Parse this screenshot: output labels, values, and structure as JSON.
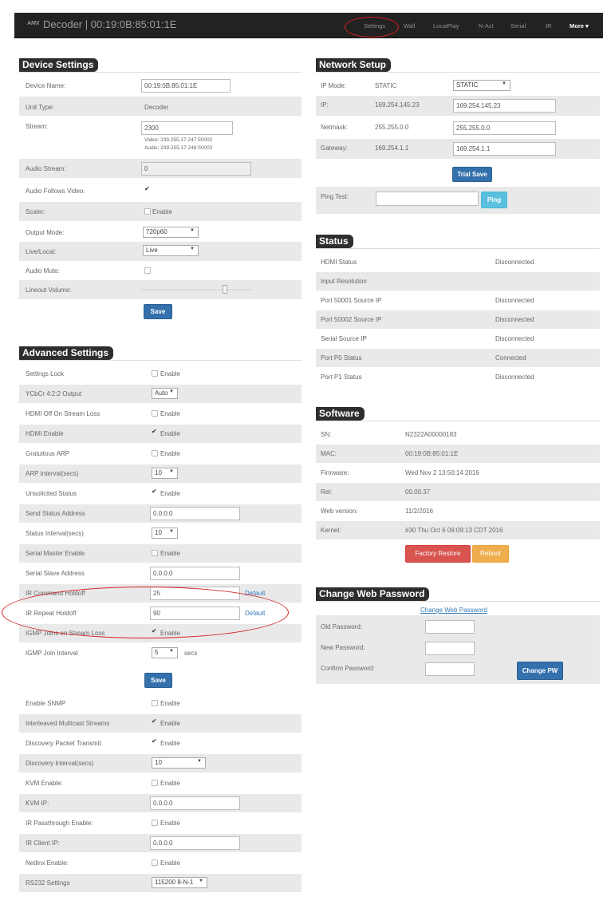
{
  "navbar": {
    "logo": "AMX",
    "title": "Decoder | 00:19:0B:85:01:1E",
    "links": [
      "Settings",
      "Wall",
      "LocalPlay",
      "N-Act",
      "Serial",
      "IR"
    ],
    "more": "More ▾"
  },
  "device_settings": {
    "title": "Device Settings",
    "device_name_label": "Device Name:",
    "device_name_value": "00:19:0B:85:01:1E",
    "unit_type_label": "Unit Type:",
    "unit_type_value": "Decoder",
    "stream_label": "Stream:",
    "stream_value": "2300",
    "stream_video": "Video: 239.255.17.247:50002",
    "stream_audio": "Audio: 239.255.17.248:50003",
    "audio_stream_label": "Audio Stream:",
    "audio_stream_value": "0",
    "audio_follows_label": "Audio Follows Video:",
    "scaler_label": "Scaler:",
    "scaler_chk": "Enable",
    "output_mode_label": "Output Mode:",
    "output_mode_value": "720p60",
    "live_local_label": "Live/Local:",
    "live_local_value": "Live",
    "audio_mute_label": "Audio Mute:",
    "lineout_label": "Lineout Volume:",
    "save": "Save"
  },
  "advanced": {
    "title": "Advanced Settings",
    "rows": [
      {
        "label": "Settings Lock",
        "kind": "chk",
        "checked": false,
        "text": "Enable"
      },
      {
        "label": "YCbCr 4:2:2 Output",
        "kind": "sel",
        "text": "Auto"
      },
      {
        "label": "HDMI Off On Stream Loss",
        "kind": "chk",
        "checked": false,
        "text": "Enable"
      },
      {
        "label": "HDMI Enable",
        "kind": "chk",
        "checked": true,
        "text": "Enable"
      },
      {
        "label": "Gratuitous ARP",
        "kind": "chk",
        "checked": false,
        "text": "Enable"
      },
      {
        "label": "ARP Interval(secs)",
        "kind": "sel",
        "text": "10"
      },
      {
        "label": "Unsolicited Status",
        "kind": "chk",
        "checked": true,
        "text": "Enable"
      },
      {
        "label": "Send Status Address",
        "kind": "inp",
        "text": "0.0.0.0"
      },
      {
        "label": "Status Interval(secs)",
        "kind": "sel",
        "text": "10"
      },
      {
        "label": "Serial Master Enable",
        "kind": "chk",
        "checked": false,
        "text": "Enable"
      },
      {
        "label": "Serial Slave Address",
        "kind": "inp",
        "text": "0.0.0.0"
      },
      {
        "label": "IR Command Holdoff",
        "kind": "inp",
        "text": "25",
        "link": "Default"
      },
      {
        "label": "IR Repeat Holdoff",
        "kind": "inp",
        "text": "90",
        "link": "Default"
      },
      {
        "label": "IGMP Joins on Stream Loss",
        "kind": "chk",
        "checked": true,
        "text": "Enable"
      },
      {
        "label": "IGMP Join Interval",
        "kind": "sel",
        "text": "5",
        "suffix": "secs"
      }
    ],
    "save": "Save",
    "rows2": [
      {
        "label": "Enable SNMP",
        "kind": "chk",
        "checked": false,
        "text": "Enable"
      },
      {
        "label": "Interleaved Multicast Streams",
        "kind": "chk",
        "checked": true,
        "text": "Enable"
      },
      {
        "label": "Discovery Packet Transmit",
        "kind": "chk",
        "checked": true,
        "text": "Enable"
      },
      {
        "label": "Discovery Interval(secs)",
        "kind": "sel",
        "text": "10"
      },
      {
        "label": "KVM Enable:",
        "kind": "chk",
        "checked": false,
        "text": "Enable"
      },
      {
        "label": "KVM IP:",
        "kind": "inp",
        "text": "0.0.0.0"
      },
      {
        "label": "IR Passthrough Enable:",
        "kind": "chk",
        "checked": false,
        "text": "Enable"
      },
      {
        "label": "IR Client IP:",
        "kind": "inp",
        "text": "0.0.0.0"
      },
      {
        "label": "Netlinx Enable:",
        "kind": "chk",
        "checked": false,
        "text": "Enable"
      },
      {
        "label": "RS232 Settings",
        "kind": "sel",
        "text": "115200 8-N-1"
      }
    ]
  },
  "network": {
    "title": "Network Setup",
    "ip_mode_label": "IP Mode:",
    "ip_mode_value": "STATIC",
    "ip_mode_select": "STATIC",
    "ip_label": "IP:",
    "ip_value": "169.254.145.23",
    "ip_input": "169.254.145.23",
    "netmask_label": "Netmask:",
    "netmask_value": "255.255.0.0",
    "netmask_input": "255.255.0.0",
    "gateway_label": "Gateway:",
    "gateway_value": "169.254.1.1",
    "gateway_input": "169.254.1.1",
    "trial_save": "Trial Save",
    "ping_label": "Ping Test:",
    "ping_button": "Ping"
  },
  "status": {
    "title": "Status",
    "rows": [
      {
        "label": "HDMI Status",
        "value": "Disconnected"
      },
      {
        "label": "Input Resolution",
        "value": ""
      },
      {
        "label": "Port 50001 Source IP",
        "value": "Disconnected"
      },
      {
        "label": "Port 50002 Source IP",
        "value": "Disconnected"
      },
      {
        "label": "Serial Source IP",
        "value": "Disconnected"
      },
      {
        "label": "Port P0 Status",
        "value": "Connected"
      },
      {
        "label": "Port P1 Status",
        "value": "Disconnected"
      }
    ]
  },
  "software": {
    "title": "Software",
    "rows": [
      {
        "label": "SN:",
        "value": "N2322A00000183"
      },
      {
        "label": "MAC:",
        "value": "00:19:0B:85:01:1E"
      },
      {
        "label": "Firmware:",
        "value": "Wed Nov 2 13:50:14 2016"
      },
      {
        "label": "Rel:",
        "value": "00.00.37"
      },
      {
        "label": "Web version:",
        "value": "11/2/2016"
      },
      {
        "label": "Kernel:",
        "value": "#30 Thu Oct 6 09:09:13 CDT 2016"
      }
    ],
    "factory_restore": "Factory Restore",
    "reboot": "Reboot"
  },
  "password": {
    "title": "Change Web Password",
    "link": "Change Web Password",
    "old_label": "Old Password:",
    "new_label": "New Password:",
    "confirm_label": "Confirm Password:",
    "button": "Change PW"
  }
}
